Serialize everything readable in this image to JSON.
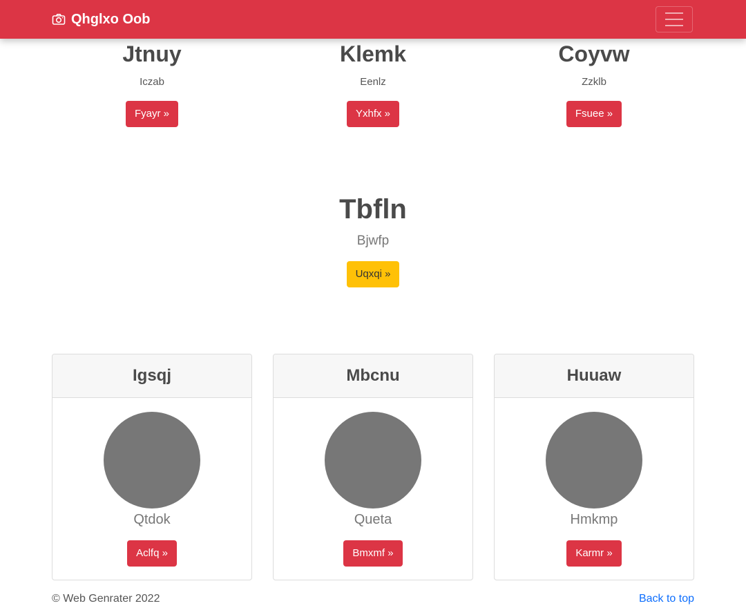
{
  "navbar": {
    "brand": "Qhglxo Oob",
    "brand_icon": "camera-icon",
    "toggler_icon": "hamburger-icon",
    "color": "#dc3545"
  },
  "features": [
    {
      "title": "Jtnuy",
      "text": "Iczab",
      "button": "Fyayr »"
    },
    {
      "title": "Klemk",
      "text": "Eenlz",
      "button": "Yxhfx »"
    },
    {
      "title": "Coyvw",
      "text": "Zzklb",
      "button": "Fsuee »"
    }
  ],
  "hero": {
    "title": "Tbfln",
    "subtitle": "Bjwfp",
    "button": "Uqxqi »",
    "button_color": "#ffc107"
  },
  "cards": [
    {
      "header": "Igsqj",
      "name": "Qtdok",
      "button": "Aclfq »"
    },
    {
      "header": "Mbcnu",
      "name": "Queta",
      "button": "Bmxmf »"
    },
    {
      "header": "Huuaw",
      "name": "Hmkmp",
      "button": "Karmr »"
    }
  ],
  "footer": {
    "copyright": "© Web Genrater 2022",
    "back_to_top": "Back to top"
  }
}
